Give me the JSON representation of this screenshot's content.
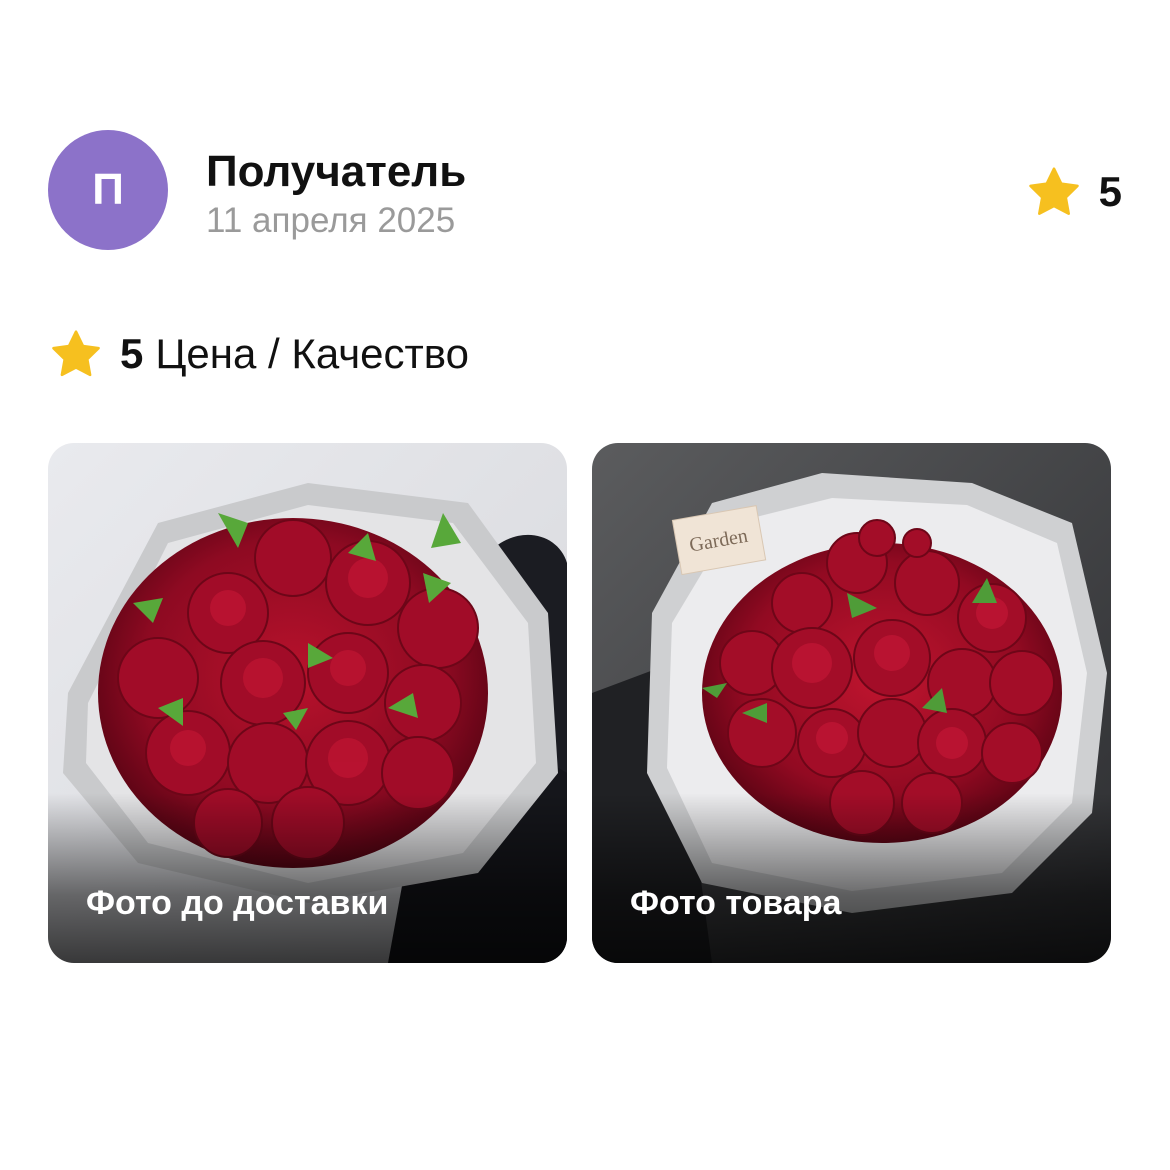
{
  "author": {
    "avatar_letter": "П",
    "name": "Получатель",
    "date": "11 апреля 2025",
    "avatar_color": "#8c72c9"
  },
  "rating": {
    "value": "5",
    "icon": "star-icon",
    "star_color": "#f6c01f"
  },
  "criteria": [
    {
      "value": "5",
      "label": "Цена / Качество",
      "icon": "star-icon"
    }
  ],
  "photos": [
    {
      "caption": "Фото до доставки"
    },
    {
      "caption": "Фото товара",
      "tag_text": "Garden"
    }
  ]
}
